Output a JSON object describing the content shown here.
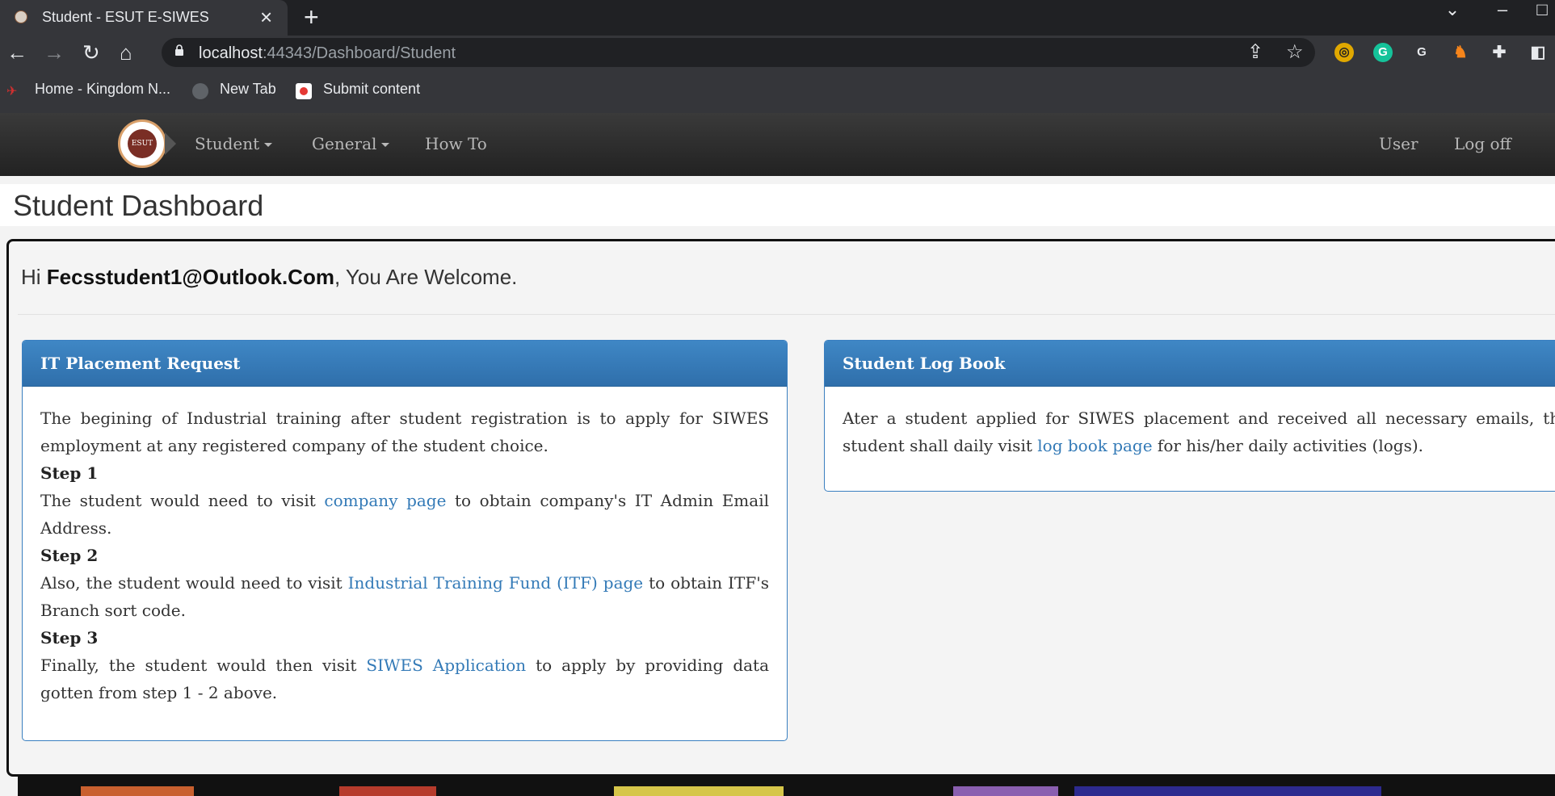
{
  "browser": {
    "tab_title": "Student - ESUT E-SIWES",
    "url_host": "localhost",
    "url_rest": ":44343/Dashboard/Student",
    "bookmarks": [
      "Home - Kingdom N...",
      "New Tab",
      "Submit content"
    ]
  },
  "nav": {
    "student": "Student",
    "general": "General",
    "howto": "How To",
    "user": "User",
    "logoff": "Log off",
    "logo_text": "ESUT"
  },
  "page": {
    "title": "Student Dashboard",
    "welcome_hi": "Hi ",
    "welcome_email": "Fecsstudent1@Outlook.Com",
    "welcome_rest": ", You Are Welcome."
  },
  "placement": {
    "header": "IT Placement Request",
    "intro": "The begining of Industrial training after student registration is to apply for SIWES employment at any registered company of the student choice.",
    "step1_label": "Step 1",
    "step1_pre": "The student would need to visit ",
    "step1_link": "company page",
    "step1_post": " to obtain company's IT Admin Email Address.",
    "step2_label": "Step 2",
    "step2_pre": "Also, the student would need to visit ",
    "step2_link": "Industrial Training Fund (ITF) page",
    "step2_post": " to obtain ITF's Branch sort code.",
    "step3_label": "Step 3",
    "step3_pre": "Finally, the student would then visit ",
    "step3_link": "SIWES Application",
    "step3_post": " to apply by providing data gotten from step 1 - 2 above."
  },
  "logbook": {
    "header": "Student Log Book",
    "pre": "Ater a student applied for SIWES placement and received all necessary emails, the student shall daily visit ",
    "link": "log book page",
    "post": " for his/her daily activities (logs)."
  }
}
